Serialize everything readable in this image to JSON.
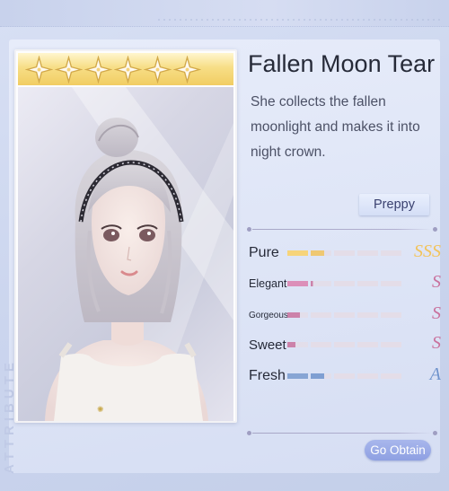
{
  "item": {
    "name": "Fallen Moon Tear",
    "description": "She collects the fallen moonlight and makes it into night crown.",
    "stars": 6,
    "style_tag": "Preppy"
  },
  "side_label": "ATTRIBUTE",
  "attributes": [
    {
      "name": "Pure",
      "fill_fraction": 0.33,
      "grade": "SSS",
      "color": "#f2c35a"
    },
    {
      "name": "Elegant",
      "fill_fraction": 0.22,
      "grade": "S",
      "color": "#c9719d"
    },
    {
      "name": "Gorgeous",
      "fill_fraction": 0.12,
      "grade": "S",
      "color": "#c9719d"
    },
    {
      "name": "Sweet",
      "fill_fraction": 0.08,
      "grade": "S",
      "color": "#c9719d"
    },
    {
      "name": "Fresh",
      "fill_fraction": 0.33,
      "grade": "A",
      "color": "#6f93cc"
    }
  ],
  "actions": {
    "go_obtain": "Go Obtain"
  },
  "colors": {
    "accent": "#8ea0e2",
    "gold": "#f1cd63",
    "panel": "#dde4f6"
  }
}
